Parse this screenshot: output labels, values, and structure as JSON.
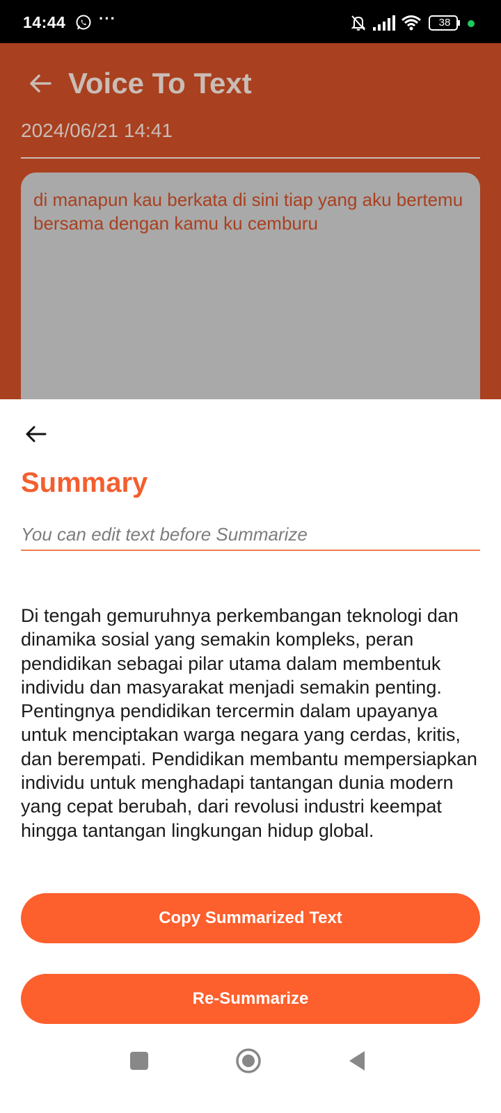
{
  "status_bar": {
    "time": "14:44",
    "dots": "···",
    "battery": "38",
    "icons": [
      "whatsapp-icon",
      "bell-muted-icon",
      "signal-icon",
      "wifi-icon",
      "battery-icon"
    ]
  },
  "background_app": {
    "title": "Voice To Text",
    "date": "2024/06/21 14:41",
    "transcript": "di manapun kau berkata di sini tiap yang aku bertemu bersama dengan kamu ku cemburu"
  },
  "sheet": {
    "title": "Summary",
    "input_placeholder": "You can edit text before Summarize",
    "summary_text": "Di tengah gemuruhnya perkembangan teknologi dan dinamika sosial yang semakin kompleks, peran pendidikan sebagai pilar utama dalam membentuk individu dan masyarakat menjadi semakin penting. Pentingnya pendidikan tercermin dalam upayanya untuk menciptakan warga negara yang cerdas, kritis, dan berempati. Pendidikan membantu mempersiapkan individu untuk menghadapi tantangan dunia modern yang cepat berubah, dari revolusi industri keempat hingga tantangan lingkungan hidup global.",
    "copy_button": "Copy Summarized Text",
    "resummarize_button": "Re-Summarize"
  },
  "colors": {
    "accent": "#fd5f2d",
    "title_accent": "#f35f30",
    "background_app": "#a94020",
    "status_dot": "#1ec95b"
  }
}
